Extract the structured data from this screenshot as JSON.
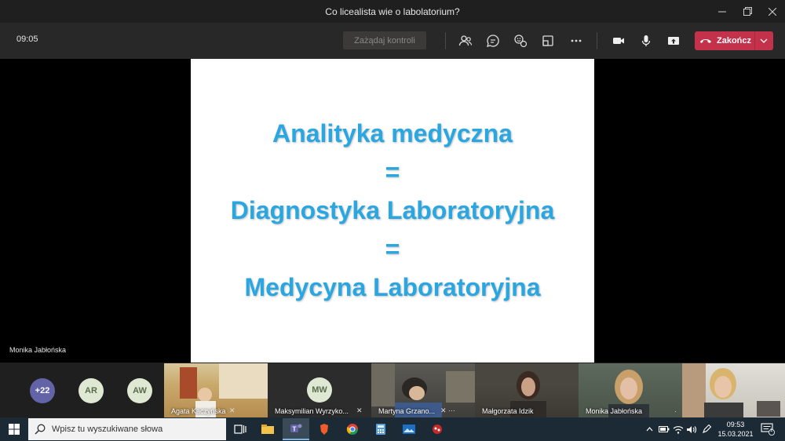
{
  "window": {
    "title": "Co licealista wie o labolatorium?"
  },
  "toolbar": {
    "timer": "09:05",
    "request_control_label": "Zażądaj kontroli",
    "end_call_label": "Zakończ"
  },
  "slide": {
    "lines": [
      "Analityka medyczna",
      "=",
      "Diagnostyka Laboratoryjna",
      "=",
      "Medycyna Laboratoryjna"
    ]
  },
  "presenter": {
    "name": "Monika Jabłońska"
  },
  "participants": {
    "more_count": "+22",
    "avatars": [
      "AR",
      "AW"
    ],
    "tiles": [
      {
        "name": "Agata Kaczyńska"
      },
      {
        "name": "Maksymilian Wyrzyko...",
        "initials": "MW"
      },
      {
        "name": "Martyna Grzano..."
      },
      {
        "name": "Małgorzata Idzik"
      },
      {
        "name": "Monika Jabłońska"
      },
      {
        "name": ""
      }
    ]
  },
  "taskbar": {
    "search_placeholder": "Wpisz tu wyszukiwane słowa",
    "time": "09:53",
    "date": "15.03.2021",
    "notification_count": "1"
  },
  "colors": {
    "slide_text": "#2aa6e0",
    "end_button": "#c4314b",
    "avatar_more": "#6264a7",
    "toolbar_bg": "#292828"
  }
}
